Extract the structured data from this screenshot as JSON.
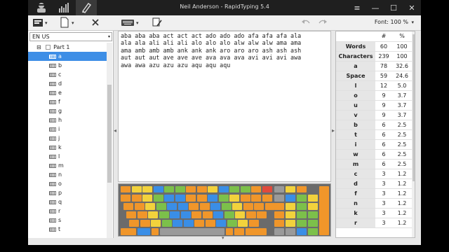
{
  "titlebar": {
    "title": "Neil Anderson - RapidTyping 5.4",
    "buttons": {
      "menu": "≡",
      "minimize": "—",
      "maximize": "☐",
      "close": "✕"
    }
  },
  "toolbar": {
    "font_zoom": "Font: 100 %",
    "caret": "▾"
  },
  "sidebar": {
    "language": "EN US",
    "tree": {
      "parent_expander": "⊟",
      "parent_label": "Part 1",
      "lessons": [
        "a",
        "b",
        "c",
        "d",
        "e",
        "f",
        "g",
        "h",
        "i",
        "j",
        "k",
        "l",
        "m",
        "n",
        "o",
        "p",
        "q",
        "r",
        "s",
        "t"
      ],
      "selected": "a"
    }
  },
  "lesson_text": {
    "lines": [
      "aba aba aba act act act ado ado ado afa afa afa ala",
      "ala ala ali ali ali alo alo alo alw alw alw ama ama",
      "ama amb amb amb ank ank ank aro aro aro ash ash ash",
      "aut aut aut ave ave ave ava ava ava avi avi avi awa",
      "awa awa azu azu azu aqu aqu aqu"
    ]
  },
  "stats": {
    "headers": [
      "",
      "#",
      "%"
    ],
    "rows": [
      [
        "Words",
        "60",
        "100"
      ],
      [
        "Characters",
        "239",
        "100"
      ],
      [
        "a",
        "78",
        "32.6"
      ],
      [
        "Space",
        "59",
        "24.6"
      ],
      [
        "l",
        "12",
        "5.0"
      ],
      [
        "o",
        "9",
        "3.7"
      ],
      [
        "u",
        "9",
        "3.7"
      ],
      [
        "v",
        "9",
        "3.7"
      ],
      [
        "b",
        "6",
        "2.5"
      ],
      [
        "t",
        "6",
        "2.5"
      ],
      [
        "i",
        "6",
        "2.5"
      ],
      [
        "w",
        "6",
        "2.5"
      ],
      [
        "m",
        "6",
        "2.5"
      ],
      [
        "c",
        "3",
        "1.2"
      ],
      [
        "d",
        "3",
        "1.2"
      ],
      [
        "f",
        "3",
        "1.2"
      ],
      [
        "n",
        "3",
        "1.2"
      ],
      [
        "k",
        "3",
        "1.2"
      ],
      [
        "r",
        "3",
        "1.2"
      ]
    ]
  },
  "splitters": {
    "left": "◂",
    "right": "▸",
    "bottom": "▾"
  },
  "colors": {
    "orange": "#f0962a",
    "yellow": "#f2d23c",
    "green": "#7cc04a",
    "blue": "#3a8ee6",
    "red": "#e04a3c",
    "gray": "#9a9a9a",
    "darkgray": "#5a5a5a",
    "selected": "#3d8ee6"
  }
}
